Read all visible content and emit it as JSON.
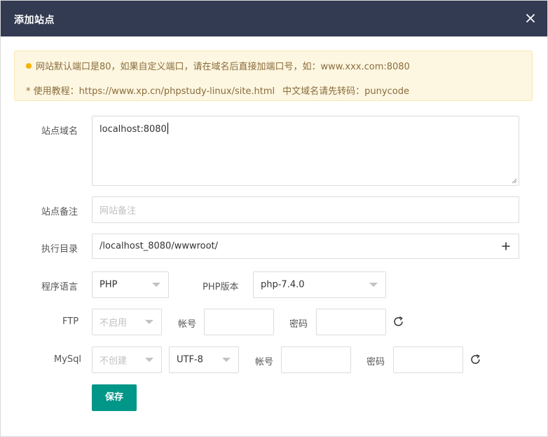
{
  "dialog": {
    "title": "添加站点",
    "close_icon": "close-icon"
  },
  "notice": {
    "line1": "网站默认端口是80，如果自定义端口，请在域名后直接加端口号，如：www.xxx.com:8080",
    "line2_part1": "* 使用教程：https://www.xp.cn/phpstudy-linux/site.html",
    "line2_part2": "中文域名请先转码：punycode",
    "bullet_color": "#f7b300"
  },
  "form": {
    "domain": {
      "label": "站点域名",
      "value": "localhost:8080"
    },
    "remark": {
      "label": "站点备注",
      "placeholder": "网站备注",
      "value": ""
    },
    "directory": {
      "label": "执行目录",
      "value": "/localhost_8080/wwwroot/",
      "icon": "plus-icon"
    },
    "language": {
      "label": "程序语言",
      "value": "PHP"
    },
    "php_version": {
      "label": "PHP版本",
      "value": "php-7.4.0"
    },
    "ftp": {
      "label": "FTP",
      "mode": "不启用",
      "account_label": "帐号",
      "account_value": "",
      "password_label": "密码",
      "password_value": "",
      "refresh_icon": "refresh-icon"
    },
    "mysql": {
      "label": "MySql",
      "mode": "不创建",
      "charset": "UTF-8",
      "account_label": "帐号",
      "account_value": "",
      "password_label": "密码",
      "password_value": "",
      "refresh_icon": "refresh-icon"
    },
    "save_label": "保存"
  },
  "colors": {
    "titlebar": "#323b51",
    "accent": "#009688",
    "notice_bg": "#fdf6e1",
    "notice_text": "#8a6d3b"
  }
}
